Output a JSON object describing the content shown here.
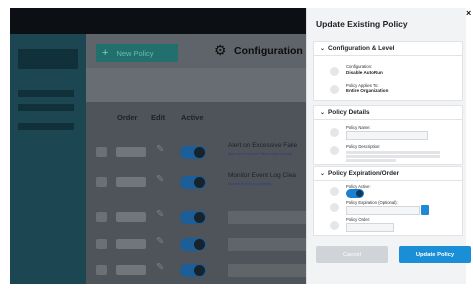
{
  "background": {
    "new_policy_label": "New Policy",
    "page_title": "Configuration",
    "columns": {
      "order": "Order",
      "edit": "Edit",
      "active": "Active"
    },
    "rows": [
      {
        "name": "Alert on Excessive Faile",
        "description": "Alert on Excessive Failed Logon Activity",
        "active": true
      },
      {
        "name": "Monitor Event Log Clea",
        "description": "Monitor Event Log Clearing",
        "active": true
      },
      {
        "name": "",
        "description": "",
        "active": true
      },
      {
        "name": "",
        "description": "",
        "active": true
      },
      {
        "name": "",
        "description": "",
        "active": true
      }
    ]
  },
  "modal": {
    "title": "Update Existing Policy",
    "close_icon": "close-icon",
    "sections": {
      "config": {
        "header": "Configuration & Level",
        "configuration_label": "Configuration:",
        "configuration_value": "Disable AutoRun",
        "applies_label": "Policy Applies To:",
        "applies_value": "Entire Organization"
      },
      "details": {
        "header": "Policy Details",
        "name_label": "Policy Name:",
        "description_label": "Policy Description:"
      },
      "expiration": {
        "header": "Policy Expiration/Order",
        "active_label": "Policy Active:",
        "active": true,
        "expiration_label": "Policy Expiration (Optional):",
        "order_label": "Policy Order:"
      }
    },
    "cancel_label": "Cancel",
    "update_label": "Update Policy"
  },
  "colors": {
    "accent": "#1b8ed8",
    "sidebar": "#1b4652",
    "new_policy": "#22706e"
  }
}
